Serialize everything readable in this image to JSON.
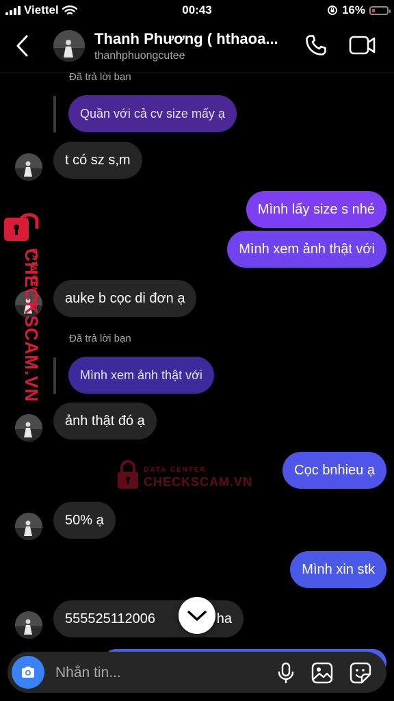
{
  "status_bar": {
    "carrier": "Viettel",
    "time": "00:43",
    "battery": "16%",
    "battery_level": 0.16
  },
  "header": {
    "name": "Thanh Phương ( hthaoa...",
    "username": "thanhphuongcutee"
  },
  "messages": [
    {
      "type": "reply-label",
      "text": "Đã trả lời bạn"
    },
    {
      "type": "reply-quote",
      "text": "Quần với cả cv size mấy ạ"
    },
    {
      "type": "in",
      "text": "t có sz s,m"
    },
    {
      "type": "out",
      "text": "Mình lấy size s nhé"
    },
    {
      "type": "out",
      "text": "Mình xem ảnh thật với"
    },
    {
      "type": "in",
      "text": "auke b cọc di đơn ạ"
    },
    {
      "type": "reply-label",
      "text": "Đã trả lời bạn"
    },
    {
      "type": "reply-quote",
      "text": "Mình xem ảnh thật với"
    },
    {
      "type": "in",
      "text": "ảnh thật đó ạ"
    },
    {
      "type": "out",
      "text": "Cọc bnhieu ạ"
    },
    {
      "type": "in",
      "text": "50% ạ"
    },
    {
      "type": "out",
      "text": "Mình xin stk"
    },
    {
      "type": "in",
      "text": "555525112006",
      "text_tail": "ha"
    }
  ],
  "composer": {
    "placeholder": "Nhắn tin..."
  },
  "watermark": {
    "top_text": "DATA CENTER",
    "main_text": "CHECKSCAM.VN"
  },
  "colors": {
    "incoming_bubble": "#262626",
    "outgoing_purple": "#7b3ff0",
    "outgoing_blue": "#4a5ae6",
    "reply_quote_purple": "#4b2896",
    "camera_button": "#3b82f6",
    "watermark": "#d81c38"
  },
  "icons": [
    "chevron-left-icon",
    "phone-icon",
    "video-camera-icon",
    "camera-icon",
    "microphone-icon",
    "gallery-icon",
    "sticker-icon",
    "chevron-down-icon",
    "lock-icon"
  ]
}
